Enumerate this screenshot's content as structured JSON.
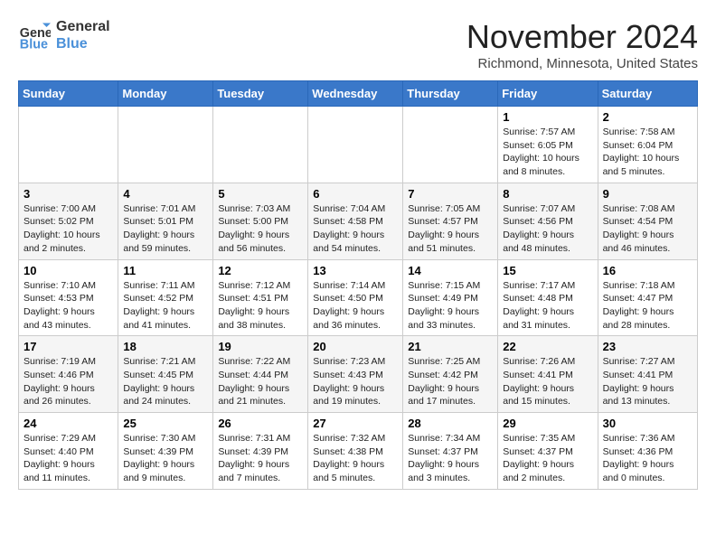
{
  "header": {
    "logo_line1": "General",
    "logo_line2": "Blue",
    "month": "November 2024",
    "location": "Richmond, Minnesota, United States"
  },
  "weekdays": [
    "Sunday",
    "Monday",
    "Tuesday",
    "Wednesday",
    "Thursday",
    "Friday",
    "Saturday"
  ],
  "weeks": [
    [
      {
        "day": "",
        "info": ""
      },
      {
        "day": "",
        "info": ""
      },
      {
        "day": "",
        "info": ""
      },
      {
        "day": "",
        "info": ""
      },
      {
        "day": "",
        "info": ""
      },
      {
        "day": "1",
        "info": "Sunrise: 7:57 AM\nSunset: 6:05 PM\nDaylight: 10 hours\nand 8 minutes."
      },
      {
        "day": "2",
        "info": "Sunrise: 7:58 AM\nSunset: 6:04 PM\nDaylight: 10 hours\nand 5 minutes."
      }
    ],
    [
      {
        "day": "3",
        "info": "Sunrise: 7:00 AM\nSunset: 5:02 PM\nDaylight: 10 hours\nand 2 minutes."
      },
      {
        "day": "4",
        "info": "Sunrise: 7:01 AM\nSunset: 5:01 PM\nDaylight: 9 hours\nand 59 minutes."
      },
      {
        "day": "5",
        "info": "Sunrise: 7:03 AM\nSunset: 5:00 PM\nDaylight: 9 hours\nand 56 minutes."
      },
      {
        "day": "6",
        "info": "Sunrise: 7:04 AM\nSunset: 4:58 PM\nDaylight: 9 hours\nand 54 minutes."
      },
      {
        "day": "7",
        "info": "Sunrise: 7:05 AM\nSunset: 4:57 PM\nDaylight: 9 hours\nand 51 minutes."
      },
      {
        "day": "8",
        "info": "Sunrise: 7:07 AM\nSunset: 4:56 PM\nDaylight: 9 hours\nand 48 minutes."
      },
      {
        "day": "9",
        "info": "Sunrise: 7:08 AM\nSunset: 4:54 PM\nDaylight: 9 hours\nand 46 minutes."
      }
    ],
    [
      {
        "day": "10",
        "info": "Sunrise: 7:10 AM\nSunset: 4:53 PM\nDaylight: 9 hours\nand 43 minutes."
      },
      {
        "day": "11",
        "info": "Sunrise: 7:11 AM\nSunset: 4:52 PM\nDaylight: 9 hours\nand 41 minutes."
      },
      {
        "day": "12",
        "info": "Sunrise: 7:12 AM\nSunset: 4:51 PM\nDaylight: 9 hours\nand 38 minutes."
      },
      {
        "day": "13",
        "info": "Sunrise: 7:14 AM\nSunset: 4:50 PM\nDaylight: 9 hours\nand 36 minutes."
      },
      {
        "day": "14",
        "info": "Sunrise: 7:15 AM\nSunset: 4:49 PM\nDaylight: 9 hours\nand 33 minutes."
      },
      {
        "day": "15",
        "info": "Sunrise: 7:17 AM\nSunset: 4:48 PM\nDaylight: 9 hours\nand 31 minutes."
      },
      {
        "day": "16",
        "info": "Sunrise: 7:18 AM\nSunset: 4:47 PM\nDaylight: 9 hours\nand 28 minutes."
      }
    ],
    [
      {
        "day": "17",
        "info": "Sunrise: 7:19 AM\nSunset: 4:46 PM\nDaylight: 9 hours\nand 26 minutes."
      },
      {
        "day": "18",
        "info": "Sunrise: 7:21 AM\nSunset: 4:45 PM\nDaylight: 9 hours\nand 24 minutes."
      },
      {
        "day": "19",
        "info": "Sunrise: 7:22 AM\nSunset: 4:44 PM\nDaylight: 9 hours\nand 21 minutes."
      },
      {
        "day": "20",
        "info": "Sunrise: 7:23 AM\nSunset: 4:43 PM\nDaylight: 9 hours\nand 19 minutes."
      },
      {
        "day": "21",
        "info": "Sunrise: 7:25 AM\nSunset: 4:42 PM\nDaylight: 9 hours\nand 17 minutes."
      },
      {
        "day": "22",
        "info": "Sunrise: 7:26 AM\nSunset: 4:41 PM\nDaylight: 9 hours\nand 15 minutes."
      },
      {
        "day": "23",
        "info": "Sunrise: 7:27 AM\nSunset: 4:41 PM\nDaylight: 9 hours\nand 13 minutes."
      }
    ],
    [
      {
        "day": "24",
        "info": "Sunrise: 7:29 AM\nSunset: 4:40 PM\nDaylight: 9 hours\nand 11 minutes."
      },
      {
        "day": "25",
        "info": "Sunrise: 7:30 AM\nSunset: 4:39 PM\nDaylight: 9 hours\nand 9 minutes."
      },
      {
        "day": "26",
        "info": "Sunrise: 7:31 AM\nSunset: 4:39 PM\nDaylight: 9 hours\nand 7 minutes."
      },
      {
        "day": "27",
        "info": "Sunrise: 7:32 AM\nSunset: 4:38 PM\nDaylight: 9 hours\nand 5 minutes."
      },
      {
        "day": "28",
        "info": "Sunrise: 7:34 AM\nSunset: 4:37 PM\nDaylight: 9 hours\nand 3 minutes."
      },
      {
        "day": "29",
        "info": "Sunrise: 7:35 AM\nSunset: 4:37 PM\nDaylight: 9 hours\nand 2 minutes."
      },
      {
        "day": "30",
        "info": "Sunrise: 7:36 AM\nSunset: 4:36 PM\nDaylight: 9 hours\nand 0 minutes."
      }
    ]
  ]
}
